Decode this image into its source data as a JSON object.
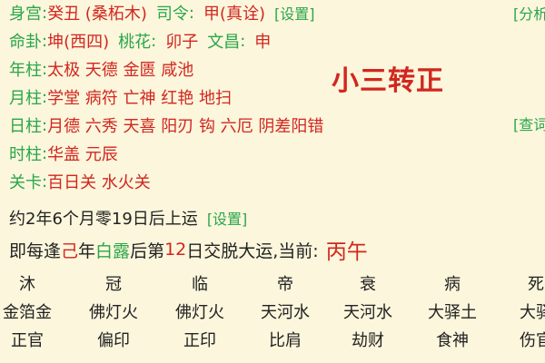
{
  "chart_rows": [
    {
      "label": "身宫",
      "parts": [
        {
          "text": "癸丑 (桑柘木)",
          "kind": "value"
        },
        {
          "text": "司令",
          "kind": "label"
        },
        {
          "text": "甲(真诠)",
          "kind": "value"
        }
      ],
      "link": "[设置]"
    },
    {
      "label": "命卦",
      "parts": [
        {
          "text": "坤(西四)",
          "kind": "value"
        },
        {
          "text": "桃花",
          "kind": "label"
        },
        {
          "text": "卯子",
          "kind": "value"
        },
        {
          "text": "文昌",
          "kind": "label"
        },
        {
          "text": "申",
          "kind": "value"
        }
      ],
      "link": ""
    },
    {
      "label": "年柱",
      "parts": [
        {
          "text": "太极 天德 金匮 咸池",
          "kind": "value"
        }
      ],
      "link": ""
    },
    {
      "label": "月柱",
      "parts": [
        {
          "text": "学堂 病符 亡神 红艳 地扫",
          "kind": "value"
        }
      ],
      "link": ""
    },
    {
      "label": "日柱",
      "parts": [
        {
          "text": "月德 六秀 天喜 阳刃 钩 六厄 阴差阳错",
          "kind": "value"
        }
      ],
      "link": ""
    },
    {
      "label": "时柱",
      "parts": [
        {
          "text": "华盖 元辰",
          "kind": "value"
        }
      ],
      "link": ""
    },
    {
      "label": "关卡",
      "parts": [
        {
          "text": "百日关 水火关",
          "kind": "value"
        }
      ],
      "link": ""
    }
  ],
  "right_links": {
    "top": "[分析",
    "middle": "[查词"
  },
  "big_note": "小三转正",
  "fate_start": {
    "text": "约2年6个月零19日后上运",
    "link": "[设置]"
  },
  "luck_line": {
    "before": "即每逢",
    "stem": "己",
    "word_year": "年",
    "solar_term": "白露",
    "after_term": "后第",
    "day_number": "12",
    "after_day": "日交脱大运,当前:",
    "current": "丙午"
  },
  "grid": {
    "rows": [
      [
        "沐",
        "冠",
        "临",
        "帝",
        "衰",
        "病",
        "死"
      ],
      [
        "金箔金",
        "佛灯火",
        "佛灯火",
        "天河水",
        "天河水",
        "大驿土",
        "大驿"
      ],
      [
        "正官",
        "偏印",
        "正印",
        "比肩",
        "劫财",
        "食神",
        "伤官"
      ]
    ]
  },
  "colors": {
    "background": "#fbf6dc",
    "label_green": "#2aa64a",
    "value_red": "#d2261f",
    "text_dark": "#222222"
  }
}
